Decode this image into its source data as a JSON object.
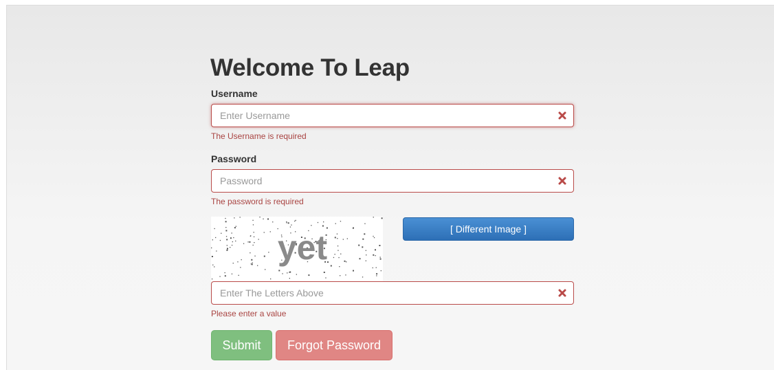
{
  "page": {
    "title": "Welcome To Leap"
  },
  "username": {
    "label": "Username",
    "value": "",
    "placeholder": "Enter Username",
    "error": "The Username is required"
  },
  "password": {
    "label": "Password",
    "value": "",
    "placeholder": "Password",
    "error": "The password is required"
  },
  "captcha": {
    "text": "yet",
    "refresh_label": "[ Different Image ]",
    "value": "",
    "placeholder": "Enter The Letters Above",
    "error": "Please enter a value"
  },
  "actions": {
    "submit_label": "Submit",
    "forgot_label": "Forgot Password"
  },
  "icons": {
    "field_error": "error-x-icon"
  },
  "colors": {
    "error": "#a94442",
    "error_border": "#b94a48",
    "primary": "#337ab7",
    "success": "#7fbf7f",
    "danger": "#e08684",
    "title": "#333333"
  }
}
